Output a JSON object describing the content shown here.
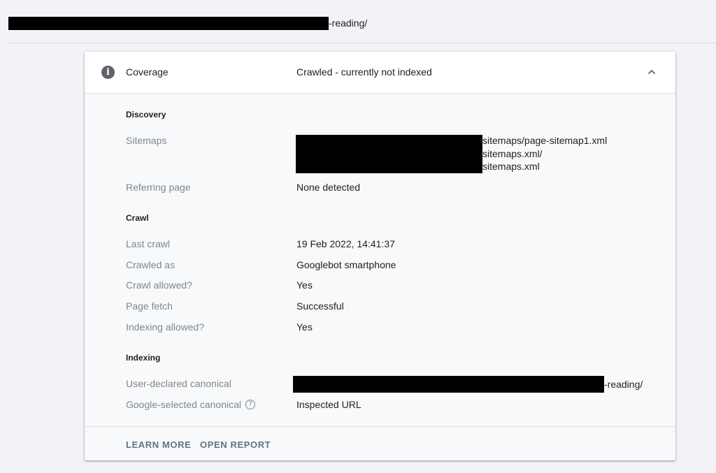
{
  "url": {
    "suffix": "-reading/"
  },
  "coverage": {
    "icon": "info-icon",
    "label": "Coverage",
    "status": "Crawled - currently not indexed",
    "toggle_icon": "chevron-up-icon"
  },
  "discovery": {
    "title": "Discovery",
    "sitemaps_label": "Sitemaps",
    "sitemaps": [
      "sitemaps/page-sitemap1.xml",
      "sitemaps.xml/",
      "sitemaps.xml"
    ],
    "referring_label": "Referring page",
    "referring_value": "None detected"
  },
  "crawl": {
    "title": "Crawl",
    "rows": [
      {
        "label": "Last crawl",
        "value": "19 Feb 2022, 14:41:37"
      },
      {
        "label": "Crawled as",
        "value": "Googlebot smartphone"
      },
      {
        "label": "Crawl allowed?",
        "value": "Yes"
      },
      {
        "label": "Page fetch",
        "value": "Successful"
      },
      {
        "label": "Indexing allowed?",
        "value": "Yes"
      }
    ]
  },
  "indexing": {
    "title": "Indexing",
    "user_canonical_label": "User-declared canonical",
    "user_canonical_suffix": "-reading/",
    "google_canonical_label": "Google-selected canonical",
    "google_canonical_value": "Inspected URL",
    "help_icon": "help-circle-icon"
  },
  "footer": {
    "learn_more": "LEARN MORE",
    "open_report": "OPEN REPORT"
  }
}
